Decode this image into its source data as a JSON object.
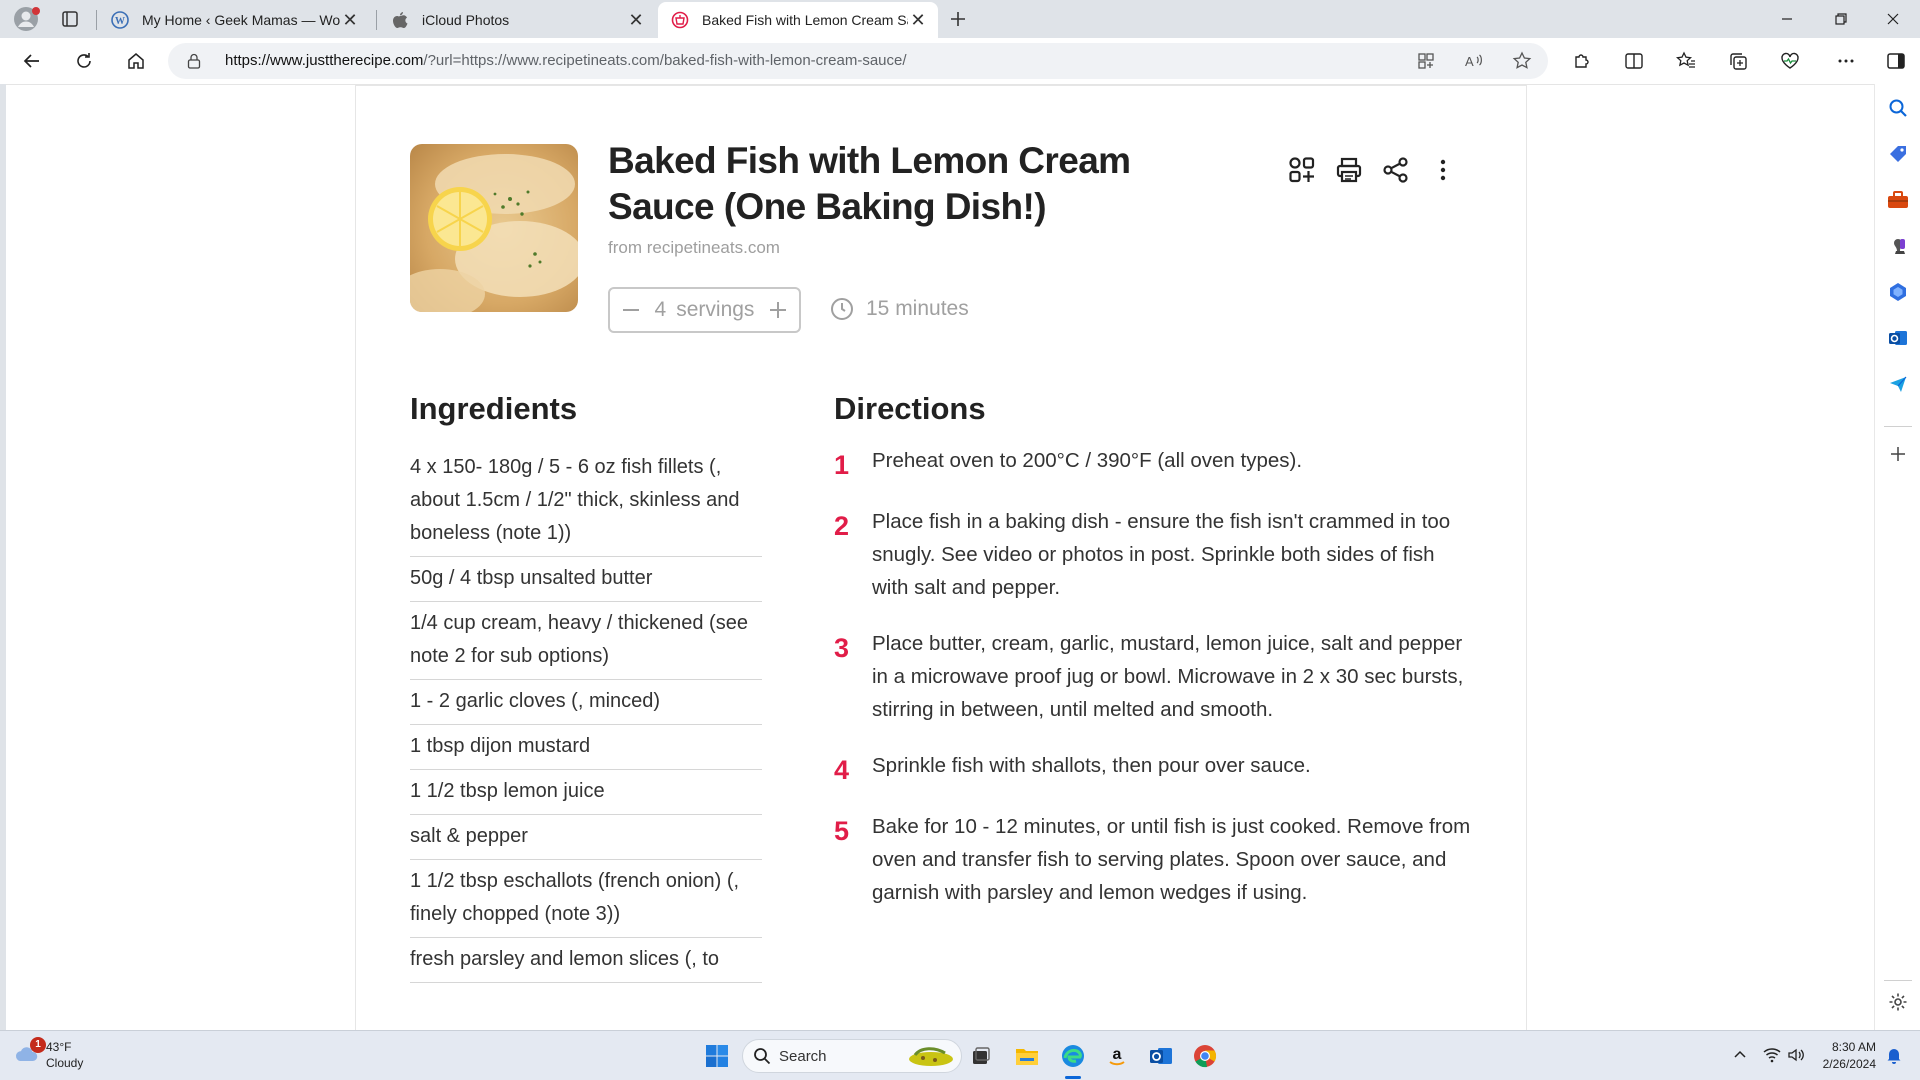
{
  "browser": {
    "tabs": [
      {
        "label": "My Home ‹ Geek Mamas — WordPress.com",
        "icon": "wordpress-icon",
        "active": false
      },
      {
        "label": "iCloud Photos",
        "icon": "apple-icon",
        "active": false
      },
      {
        "label": "Baked Fish with Lemon Cream Sauce",
        "icon": "recipe-icon",
        "active": true
      }
    ],
    "address": {
      "url_domain": "https://www.justtherecipe.com",
      "url_rest": "/?url=https://www.recipetineats.com/baked-fish-with-lemon-cream-sauce/"
    }
  },
  "recipe": {
    "title": "Baked Fish with Lemon Cream Sauce (One Baking Dish!)",
    "source": "from recipetineats.com",
    "servings_count": "4",
    "servings_label": "servings",
    "time": "15 minutes",
    "ingredients_heading": "Ingredients",
    "directions_heading": "Directions",
    "ingredients": [
      "4 x 150- 180g / 5 - 6 oz fish fillets (, about 1.5cm / 1/2\" thick, skinless and boneless (note 1))",
      "50g / 4 tbsp unsalted butter",
      "1/4 cup cream, heavy / thickened (see note 2 for sub options)",
      "1 - 2 garlic cloves (, minced)",
      "1 tbsp dijon mustard",
      "1 1/2 tbsp lemon juice",
      "salt & pepper",
      "1 1/2 tbsp eschallots (french onion) (, finely chopped (note 3))",
      "fresh parsley and lemon slices (, to"
    ],
    "directions": [
      {
        "num": "1",
        "text": "Preheat oven to 200°C / 390°F (all oven types)."
      },
      {
        "num": "2",
        "text": "Place fish in a baking dish - ensure the fish isn't crammed in too snugly. See video or photos in post. Sprinkle both sides of fish with salt and pepper."
      },
      {
        "num": "3",
        "text": "Place butter, cream, garlic, mustard, lemon juice, salt and pepper in a microwave proof jug or bowl. Microwave in 2 x 30 sec bursts, stirring in between, until melted and smooth."
      },
      {
        "num": "4",
        "text": "Sprinkle fish with shallots, then pour over sauce."
      },
      {
        "num": "5",
        "text": "Bake for 10 - 12 minutes, or until fish is just cooked. Remove from oven and transfer fish to serving plates. Spoon over sauce, and garnish with parsley and lemon wedges if using."
      }
    ]
  },
  "taskbar": {
    "weather_temp": "43°F",
    "weather_desc": "Cloudy",
    "weather_badge": "1",
    "search_placeholder": "Search",
    "time": "8:30 AM",
    "date": "2/26/2024"
  },
  "colors": {
    "accent_red": "#e11d48",
    "edge_blue": "#0b66d8"
  }
}
